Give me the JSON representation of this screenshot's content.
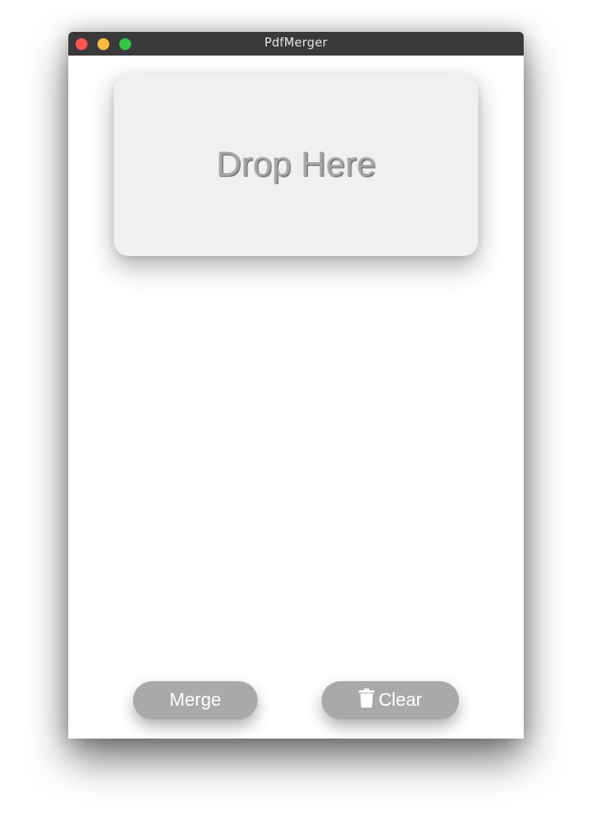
{
  "window": {
    "title": "PdfMerger"
  },
  "dropzone": {
    "label": "Drop Here"
  },
  "actions": {
    "merge_label": "Merge",
    "clear_label": "Clear",
    "clear_icon": "trash-icon"
  },
  "colors": {
    "titlebar": "#3a3a3a",
    "close": "#fc5753",
    "minimize": "#fdbc40",
    "maximize": "#33c748",
    "button": "#a9a9a9",
    "dropzone": "#f0f0f0"
  }
}
